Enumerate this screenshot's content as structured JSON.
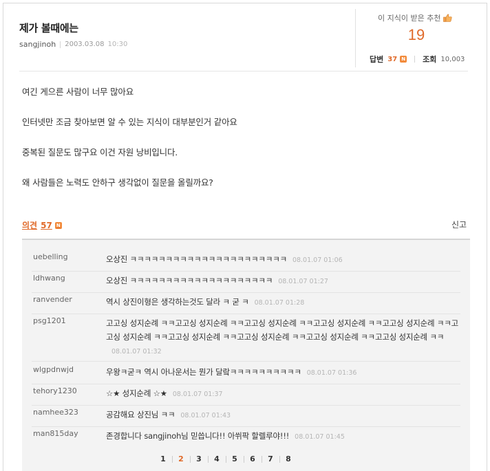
{
  "post": {
    "title": "제가 볼때에는",
    "author": "sangjinoh",
    "date": "2003.03.08",
    "time": "10:30"
  },
  "stats": {
    "recommend_label": "이 지식이 받은 추천",
    "recommend_count": "19",
    "answers_label": "답변",
    "answers_count": "37",
    "views_label": "조회",
    "views_count": "10,003",
    "new_badge": "N"
  },
  "body": [
    "여긴 게으른 사람이 너무 많아요",
    "인터넷만 조금 찾아보면 알 수 있는 지식이 대부분인거 같아요",
    "중복된 질문도 많구요 이건 자원 낭비입니다.",
    "왜 사람들은 노력도 안하구 생각없이 질문을 올릴까요?"
  ],
  "opinions": {
    "label": "의견",
    "count": "57",
    "new_badge": "N",
    "report_label": "신고"
  },
  "comments": [
    {
      "user": "uebelling",
      "text": "오상진 ㅋㅋㅋㅋㅋㅋㅋㅋㅋㅋㅋㅋㅋㅋㅋㅋㅋㅋㅋㅋㅋㅋ",
      "time": "08.01.07 01:06"
    },
    {
      "user": "ldhwang",
      "text": "오상진 ㅋㅋㅋㅋㅋㅋㅋㅋㅋㅋㅋㅋㅋㅋㅋㅋㅋㅋㅋㅋ",
      "time": "08.01.07 01:27"
    },
    {
      "user": "ranvender",
      "text": "역시 상진이형은 생각하는것도 달라 ㅋ 굳 ㅋ",
      "time": "08.01.07 01:28"
    },
    {
      "user": "psg1201",
      "text": "고고싱 성지순례 ㅋㅋ고고싱 성지순례 ㅋㅋ고고싱 성지순례 ㅋㅋ고고싱 성지순례 ㅋㅋ고고싱 성지순례 ㅋㅋ고고싱 성지순례 ㅋㅋ고고싱 성지순례 ㅋㅋ고고싱 성지순례 ㅋㅋ고고싱 성지순례 ㅋㅋ고고싱 성지순례 ㅋㅋ",
      "time": "08.01.07 01:32"
    },
    {
      "user": "wlgpdnwjd",
      "text": "우왕ㅋ굳ㅋ 역시 아나운서는 뭔가 달랔ㅋㅋㅋㅋㅋㅋㅋㅋㅋㅋ",
      "time": "08.01.07 01:36"
    },
    {
      "user": "tehory1230",
      "text": "☆★ 성지순례 ☆★",
      "time": "08.01.07 01:37"
    },
    {
      "user": "namhee323",
      "text": "공감해요 상진님 ㅋㅋ",
      "time": "08.01.07 01:43"
    },
    {
      "user": "man815day",
      "text": "존경합니다 sangjinoh님 믿씁니다!! 아쒸팍 할렐루야!!!",
      "time": "08.01.07 01:45"
    }
  ],
  "pagination": {
    "pages": [
      "1",
      "2",
      "3",
      "4",
      "5",
      "6",
      "7",
      "8"
    ],
    "current": "2"
  },
  "colors": {
    "accent": "#e06a2a",
    "panel_bg": "#f3f3f3"
  }
}
